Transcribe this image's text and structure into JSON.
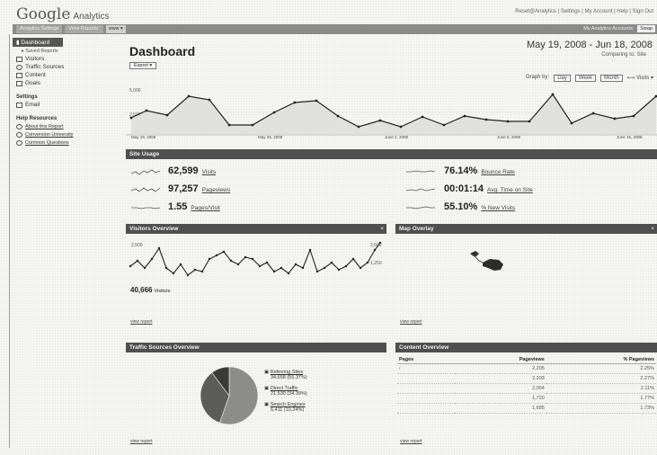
{
  "header": {
    "logo_text": "Google",
    "logo_sub": "Analytics",
    "top_links": "Reset@Analytics | Settings | My Account | Help | Sign Out"
  },
  "account_bar": {
    "tabs": [
      "Analytics Settings",
      "View Reports:"
    ],
    "profile_select": "www",
    "right_label": "My Analytics Accounts:",
    "right_button": "Swap"
  },
  "sidebar": {
    "dashboard": "Dashboard",
    "saved_reports": "Saved Reports",
    "items": [
      "Visitors",
      "Traffic Sources",
      "Content",
      "Goals"
    ],
    "settings_head": "Settings",
    "settings_item": "Email",
    "help_head": "Help Resources",
    "help_items": [
      "About this Report",
      "Conversion University",
      "Common Questions"
    ]
  },
  "main": {
    "title": "Dashboard",
    "date_range": "May 19, 2008 - Jun 18, 2008",
    "compare_label": "Comparing to: Site",
    "export_button": "Export",
    "graph_by": {
      "label": "Graph by:",
      "options": [
        "Day",
        "Week",
        "Month"
      ]
    },
    "visits_label": "Visits",
    "y_top": "5,000",
    "y_mid": "2,500",
    "x_labels": [
      "May 19, 2008",
      "May 26, 2008",
      "June 2, 2008",
      "June 9, 2008",
      "June 16, 2008"
    ]
  },
  "site_usage": {
    "heading": "Site Usage",
    "metrics": [
      {
        "value": "62,599",
        "label": "Visits"
      },
      {
        "value": "97,257",
        "label": "Pageviews"
      },
      {
        "value": "1.55",
        "label": "Pages/Visit"
      },
      {
        "value": "76.14%",
        "label": "Bounce Rate"
      },
      {
        "value": "00:01:14",
        "label": "Avg. Time on Site"
      },
      {
        "value": "55.10%",
        "label": "% New Visits"
      }
    ]
  },
  "visitors_overview": {
    "heading": "Visitors Overview",
    "total": "40,666",
    "total_label": "Visitors",
    "view_report": "view report",
    "y_top": "2,500",
    "y_right": "2,500",
    "y_right2": "1,250"
  },
  "map_overlay": {
    "heading": "Map Overlay",
    "view_report": "view report"
  },
  "traffic_sources": {
    "heading": "Traffic Sources Overview",
    "view_report": "view report",
    "slices": [
      {
        "label": "Referring Sites",
        "detail": "34,658 (55.37%)",
        "value": 55.37,
        "color": "#8c8c8a"
      },
      {
        "label": "Direct Traffic",
        "detail": "21,530 (34.39%)",
        "value": 34.39,
        "color": "#5c5c5a"
      },
      {
        "label": "Search Engines",
        "detail": "6,411 (10.24%)",
        "value": 10.24,
        "color": "#3a3a38"
      }
    ]
  },
  "content_overview": {
    "heading": "Content Overview",
    "view_report": "view report",
    "columns": [
      "Pages",
      "Pageviews",
      "% Pageviews"
    ],
    "rows": [
      {
        "page": "/",
        "pageviews": "2,205",
        "pct": "2.25%"
      },
      {
        "page": "",
        "pageviews": "2,203",
        "pct": "2.27%"
      },
      {
        "page": "",
        "pageviews": "2,054",
        "pct": "2.11%"
      },
      {
        "page": "",
        "pageviews": "1,720",
        "pct": "1.77%"
      },
      {
        "page": "",
        "pageviews": "1,685",
        "pct": "1.73%"
      }
    ]
  }
}
